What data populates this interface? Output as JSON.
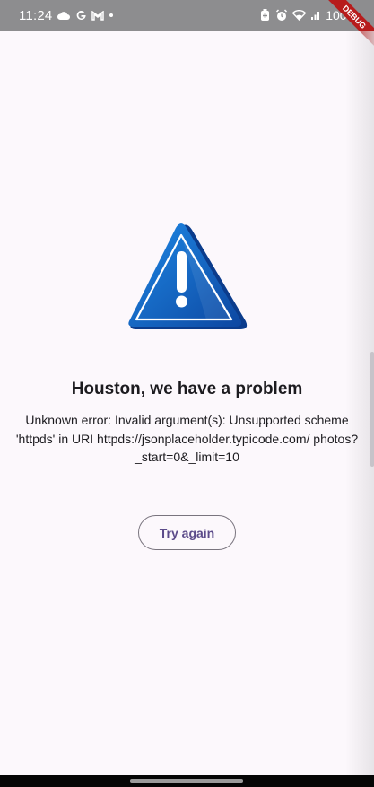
{
  "status_bar": {
    "time": "11:24",
    "left_icons": [
      "cloud-icon",
      "google-icon",
      "gmail-icon",
      "notification-dot-icon"
    ],
    "battery": "100%",
    "right_icons": [
      "battery-saver-icon",
      "alarm-icon",
      "wifi-icon",
      "signal-icon"
    ]
  },
  "debug_banner": {
    "label": "DEBUG"
  },
  "error": {
    "icon": "warning-icon",
    "title": "Houston, we have a problem",
    "message": "Unknown error: Invalid argument(s): Unsupported scheme 'httpds' in URI httpds://jsonplaceholder.typicode.com/ photos?_start=0&_limit=10"
  },
  "actions": {
    "retry_label": "Try again"
  },
  "colors": {
    "accent": "#5c4b8a",
    "background": "#fcf8fc",
    "warning_blue": "#1565c0",
    "debug_red": "#b71c1c"
  }
}
